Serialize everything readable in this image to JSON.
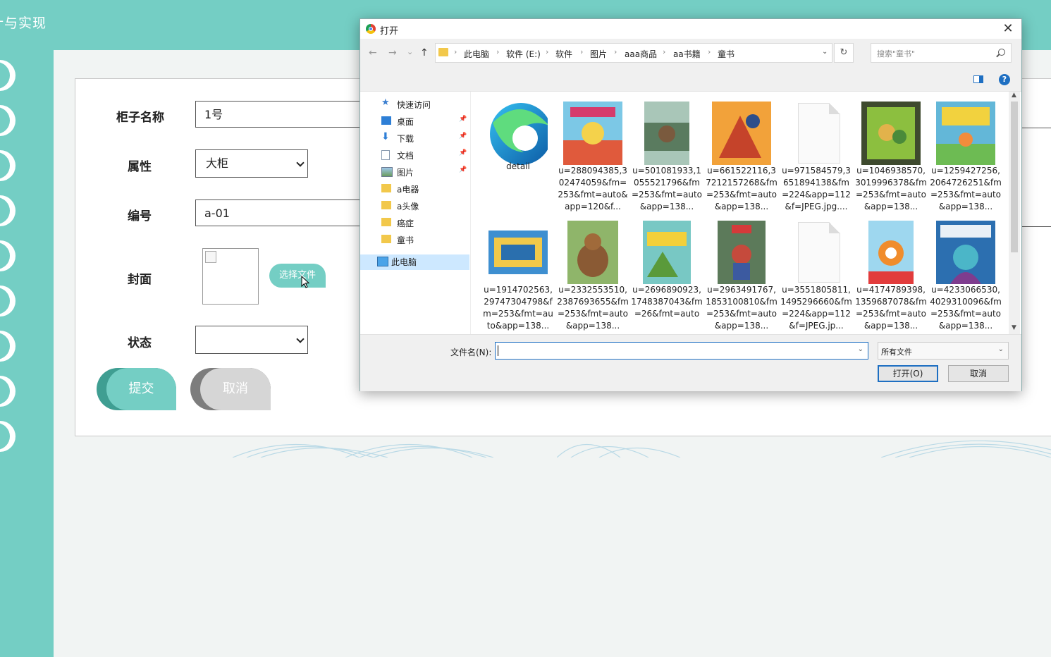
{
  "app": {
    "title": "计与实现"
  },
  "form": {
    "cabinet_name_label": "柜子名称",
    "cabinet_name_value": "1号",
    "attribute_label": "属性",
    "attribute_value": "大柜",
    "number_label": "编号",
    "number_value": "a-01",
    "cover_label": "封面",
    "choose_file_label": "选择文件",
    "status_label": "状态",
    "status_value": "",
    "submit_label": "提交",
    "cancel_label": "取消"
  },
  "dialog": {
    "title": "打开",
    "close_glyph": "✕",
    "nav": {
      "back": "←",
      "forward": "→",
      "recent": "⌄",
      "up": "↑"
    },
    "breadcrumb": [
      "此电脑",
      "软件 (E:)",
      "软件",
      "图片",
      "aaa商品",
      "aa书籍",
      "童书"
    ],
    "refresh_glyph": "↻",
    "search_placeholder": "搜索\"童书\"",
    "help_glyph": "?",
    "nav_pane": [
      {
        "label": "快速访问",
        "icon": "star-icon",
        "pinned": false
      },
      {
        "label": "桌面",
        "icon": "desktop-icon",
        "pinned": true
      },
      {
        "label": "下载",
        "icon": "download-icon",
        "pinned": true
      },
      {
        "label": "文档",
        "icon": "document-icon",
        "pinned": true
      },
      {
        "label": "图片",
        "icon": "pictures-icon",
        "pinned": true
      },
      {
        "label": "a电器",
        "icon": "folder-icon",
        "pinned": false
      },
      {
        "label": "a头像",
        "icon": "folder-icon",
        "pinned": false
      },
      {
        "label": "癌症",
        "icon": "folder-icon",
        "pinned": false
      },
      {
        "label": "童书",
        "icon": "folder-icon",
        "pinned": false
      },
      {
        "label": "此电脑",
        "icon": "computer-icon",
        "pinned": false
      }
    ],
    "pin_glyph": "📌",
    "files": [
      {
        "name": "detail",
        "kind": "edge-icon"
      },
      {
        "name": "u=288094385,302474059&fm=253&fmt=auto&app=120&f...",
        "kind": "book"
      },
      {
        "name": "u=501081933,1055521796&fm=253&fmt=auto&app=138...",
        "kind": "book"
      },
      {
        "name": "u=661522116,37212157268&fm=253&fmt=auto&app=138...",
        "kind": "book"
      },
      {
        "name": "u=971584579,3651894138&fm=224&app=112&f=JPEG.jpg....",
        "kind": "blank"
      },
      {
        "name": "u=1046938570,3019996378&fm=253&fmt=auto&app=138...",
        "kind": "book"
      },
      {
        "name": "u=1259427256,2064726251&fm=253&fmt=auto&app=138...",
        "kind": "book"
      },
      {
        "name": "u=1914702563,29747304798&fm=253&fmt=auto&app=138...",
        "kind": "book"
      },
      {
        "name": "u=2332553510,2387693655&fm=253&fmt=auto&app=138...",
        "kind": "book"
      },
      {
        "name": "u=2696890923,1748387043&fm=26&fmt=auto",
        "kind": "book"
      },
      {
        "name": "u=2963491767,1853100810&fm=253&fmt=auto&app=138...",
        "kind": "book"
      },
      {
        "name": "u=3551805811,1495296660&fm=224&app=112&f=JPEG.jp...",
        "kind": "blank"
      },
      {
        "name": "u=4174789398,1359687078&fm=253&fmt=auto&app=138...",
        "kind": "book"
      },
      {
        "name": "u=4233066530,4029310096&fm=253&fmt=auto&app=138...",
        "kind": "book"
      }
    ],
    "filename_label": "文件名(N):",
    "filename_value": "",
    "filetype_value": "所有文件",
    "open_label": "打开(O)",
    "cancel_label": "取消"
  },
  "colors": {
    "accent": "#74cec4",
    "accent_dark": "#3f9e92",
    "dialog_blue": "#1e6fc2"
  }
}
